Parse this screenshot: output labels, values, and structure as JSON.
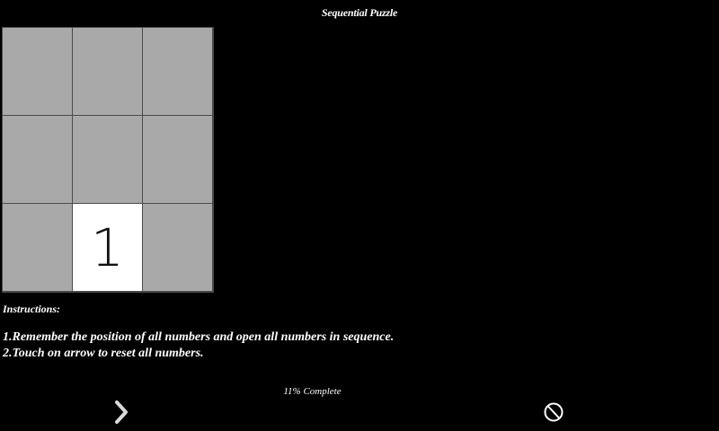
{
  "header": {
    "title": "Sequential Puzzle"
  },
  "grid": {
    "cells": [
      {
        "label": "",
        "state": "closed"
      },
      {
        "label": "",
        "state": "closed"
      },
      {
        "label": "",
        "state": "closed"
      },
      {
        "label": "",
        "state": "closed"
      },
      {
        "label": "",
        "state": "closed"
      },
      {
        "label": "",
        "state": "closed"
      },
      {
        "label": "",
        "state": "closed"
      },
      {
        "label": "1",
        "state": "open"
      },
      {
        "label": "",
        "state": "closed"
      }
    ]
  },
  "instructions": {
    "heading": "Instructions:",
    "lines": [
      "1.Remember the position of all numbers and open all numbers in sequence.",
      "2.Touch on arrow to reset all numbers."
    ]
  },
  "status": {
    "progress_text": "11% Complete",
    "progress_value": 0.11
  },
  "controls": {
    "next_icon": "chevron-right-icon",
    "stop_icon": "prohibited-icon"
  },
  "colors": {
    "background": "#000000",
    "closed_cell": "#a9a9a9",
    "open_cell": "#ffffff",
    "grid_line": "#4a4a4a"
  }
}
